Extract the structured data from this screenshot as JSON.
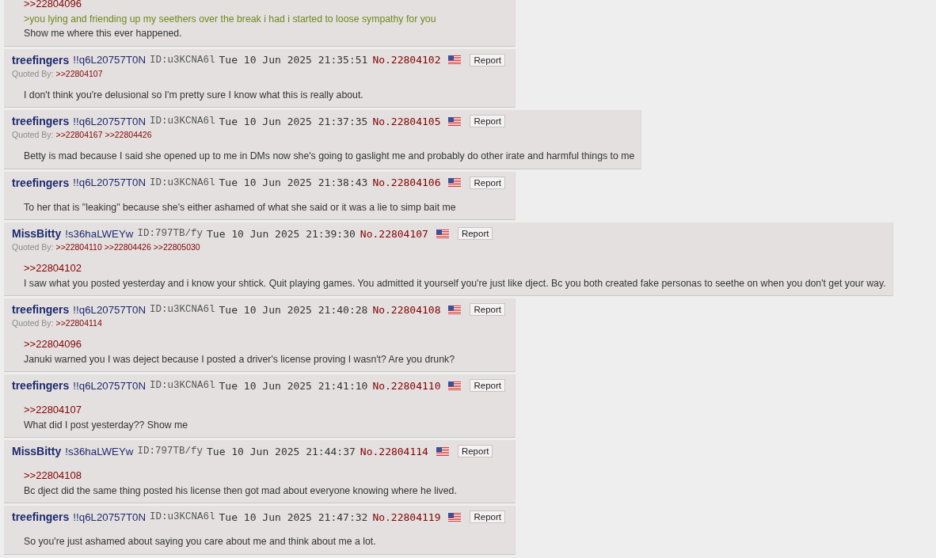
{
  "posts": [
    {
      "lines": [
        {
          "kind": "quote",
          "text": ">>22804096"
        },
        {
          "kind": "greentext",
          "text": ">you lying and friending up my seethers over the break i had i started to loose sympathy for you"
        },
        {
          "kind": "text",
          "text": "Show me where this ever happened."
        }
      ]
    },
    {
      "name": "treefingers",
      "tripcode": "!!q6L20757T0N",
      "id": "ID:u3KCNA6l",
      "datetime": "Tue 10 Jun 2025 21:35:51",
      "number": "No.22804102",
      "report": "Report",
      "quoted_by_label": "Quoted By:",
      "quoted_by": [
        ">>22804107"
      ],
      "lines": [
        {
          "kind": "text",
          "text": "I don't think you're delusional so I'm pretty sure I know what this is really about."
        }
      ]
    },
    {
      "name": "treefingers",
      "tripcode": "!!q6L20757T0N",
      "id": "ID:u3KCNA6l",
      "datetime": "Tue 10 Jun 2025 21:37:35",
      "number": "No.22804105",
      "report": "Report",
      "quoted_by_label": "Quoted By:",
      "quoted_by": [
        ">>22804167",
        ">>22804426"
      ],
      "lines": [
        {
          "kind": "text",
          "text": "Betty is mad because I said she opened up to me in DMs now she's going to gaslight me and probably do other irate and harmful things to me"
        }
      ]
    },
    {
      "name": "treefingers",
      "tripcode": "!!q6L20757T0N",
      "id": "ID:u3KCNA6l",
      "datetime": "Tue 10 Jun 2025 21:38:43",
      "number": "No.22804106",
      "report": "Report",
      "lines": [
        {
          "kind": "text",
          "text": "To her that is \"leaking\" because she's either ashamed of what she said or it was a lie to simp bait me"
        }
      ]
    },
    {
      "name": "MissBitty",
      "tripcode": "!s36haLWEYw",
      "id": "ID:797TB/fy",
      "datetime": "Tue 10 Jun 2025 21:39:30",
      "number": "No.22804107",
      "report": "Report",
      "quoted_by_label": "Quoted By:",
      "quoted_by": [
        ">>22804110",
        ">>22804426",
        ">>22805030"
      ],
      "lines": [
        {
          "kind": "quote",
          "text": ">>22804102"
        },
        {
          "kind": "text",
          "text": "I saw what you posted yesterday and i know your shtick. Quit playing games. You admitted it yourself you're just like dject. Bc you both created fake personas to seethe on when you don't get your way."
        }
      ]
    },
    {
      "name": "treefingers",
      "tripcode": "!!q6L20757T0N",
      "id": "ID:u3KCNA6l",
      "datetime": "Tue 10 Jun 2025 21:40:28",
      "number": "No.22804108",
      "report": "Report",
      "quoted_by_label": "Quoted By:",
      "quoted_by": [
        ">>22804114"
      ],
      "lines": [
        {
          "kind": "quote",
          "text": ">>22804096"
        },
        {
          "kind": "text",
          "text": "Januki warned you I was deject because I posted a driver's license proving I wasn't? Are you drunk?"
        }
      ]
    },
    {
      "name": "treefingers",
      "tripcode": "!!q6L20757T0N",
      "id": "ID:u3KCNA6l",
      "datetime": "Tue 10 Jun 2025 21:41:10",
      "number": "No.22804110",
      "report": "Report",
      "lines": [
        {
          "kind": "quote",
          "text": ">>22804107"
        },
        {
          "kind": "text",
          "text": "What did I post yesterday?? Show me"
        }
      ]
    },
    {
      "name": "MissBitty",
      "tripcode": "!s36haLWEYw",
      "id": "ID:797TB/fy",
      "datetime": "Tue 10 Jun 2025 21:44:37",
      "number": "No.22804114",
      "report": "Report",
      "lines": [
        {
          "kind": "quote",
          "text": ">>22804108"
        },
        {
          "kind": "text",
          "text": "Bc dject did the same thing posted his license then got mad about everyone knowing where he lived."
        }
      ]
    },
    {
      "name": "treefingers",
      "tripcode": "!!q6L20757T0N",
      "id": "ID:u3KCNA6l",
      "datetime": "Tue 10 Jun 2025 21:47:32",
      "number": "No.22804119",
      "report": "Report",
      "lines": [
        {
          "kind": "text",
          "text": "So you're just ashamed about saying you care about me and think about me a lot."
        }
      ]
    }
  ]
}
